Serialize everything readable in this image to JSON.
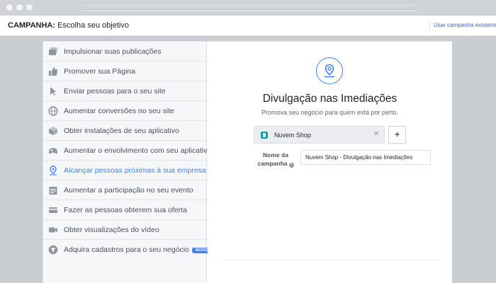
{
  "header": {
    "title_strong": "CAMPANHA:",
    "title_rest": " Escolha seu objetivo",
    "link": "Usar campanha existente"
  },
  "objectives": [
    {
      "label": "Impulsionar suas publicações",
      "icon": "posts-icon"
    },
    {
      "label": "Promover sua Página",
      "icon": "thumbs-up-icon"
    },
    {
      "label": "Enviar pessoas para o seu site",
      "icon": "cursor-icon"
    },
    {
      "label": "Aumentar conversões no seu site",
      "icon": "globe-icon"
    },
    {
      "label": "Obter instalações de seu aplicativo",
      "icon": "box-icon"
    },
    {
      "label": "Aumentar o envolvimento com seu aplicativo",
      "icon": "gamepad-icon"
    },
    {
      "label": "Alcançar pessoas próximas à sua empresa",
      "icon": "location-pin-icon",
      "active": true
    },
    {
      "label": "Aumentar a participação no seu evento",
      "icon": "calendar-icon"
    },
    {
      "label": "Fazer as pessoas obterem sua oferta",
      "icon": "offer-icon"
    },
    {
      "label": "Obter visualizações do vídeo",
      "icon": "video-camera-icon"
    },
    {
      "label": "Adquira cadastros para o seu negócio",
      "icon": "funnel-icon",
      "badge": "NOVO"
    }
  ],
  "detail": {
    "icon": "location-pin-icon",
    "title": "Divulgação nas Imediações",
    "subtitle": "Promova seu negócio para quem está por perto.",
    "page_name": "Nuvem Shop",
    "add_label": "+",
    "campaign_label_line1": "Nome da",
    "campaign_label_line2": "campanha",
    "campaign_name": "Nuvem Shop - Divulgação nas Imediações"
  },
  "colors": {
    "accent": "#4080ff",
    "text": "#4b4f56",
    "list_bg": "#f6f7f9",
    "page_bg": "#c9ccd1"
  }
}
